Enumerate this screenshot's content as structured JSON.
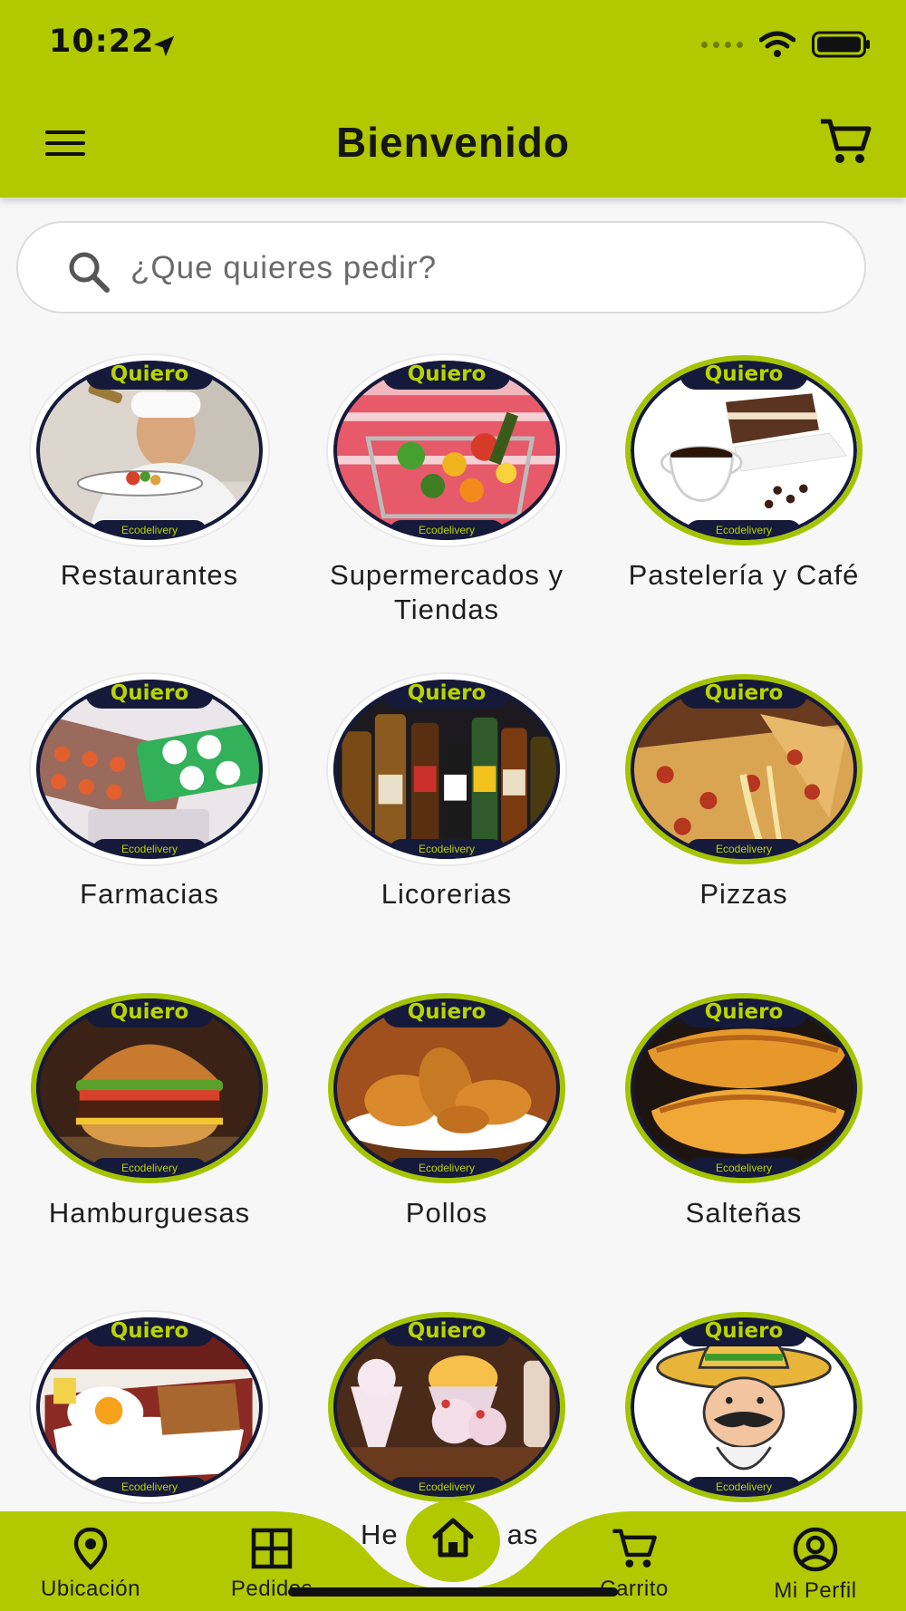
{
  "status_bar": {
    "time": "10:22"
  },
  "header": {
    "title": "Bienvenido",
    "menu_icon": "hamburger-menu-icon",
    "cart_icon": "cart-icon"
  },
  "search": {
    "placeholder": "¿Que quieres pedir?",
    "value": ""
  },
  "badge": {
    "top": "Quiero",
    "bottom": "Ecodelivery"
  },
  "categories": [
    {
      "label": "Restaurantes"
    },
    {
      "label": "Supermercados y Tiendas"
    },
    {
      "label": "Pastelería y Café"
    },
    {
      "label": "Farmacias"
    },
    {
      "label": "Licorerias"
    },
    {
      "label": "Pizzas"
    },
    {
      "label": "Hamburguesas"
    },
    {
      "label": "Pollos"
    },
    {
      "label": "Salteñas"
    },
    {
      "label": ""
    },
    {
      "label": "Helados"
    },
    {
      "label": ""
    }
  ],
  "peek_label": {
    "left": "He",
    "right": "as"
  },
  "bottom_nav": {
    "items": [
      {
        "label": "Ubicación",
        "icon": "location-pin-icon"
      },
      {
        "label": "Pedidos",
        "icon": "grid-icon"
      },
      {
        "label": "Carrito",
        "icon": "cart-icon"
      },
      {
        "label": "Mi Perfil",
        "icon": "profile-icon"
      }
    ],
    "center": {
      "icon": "home-icon"
    }
  },
  "colors": {
    "accent": "#b2c900",
    "badge": "#151a3a",
    "background": "#f7f7f7"
  }
}
